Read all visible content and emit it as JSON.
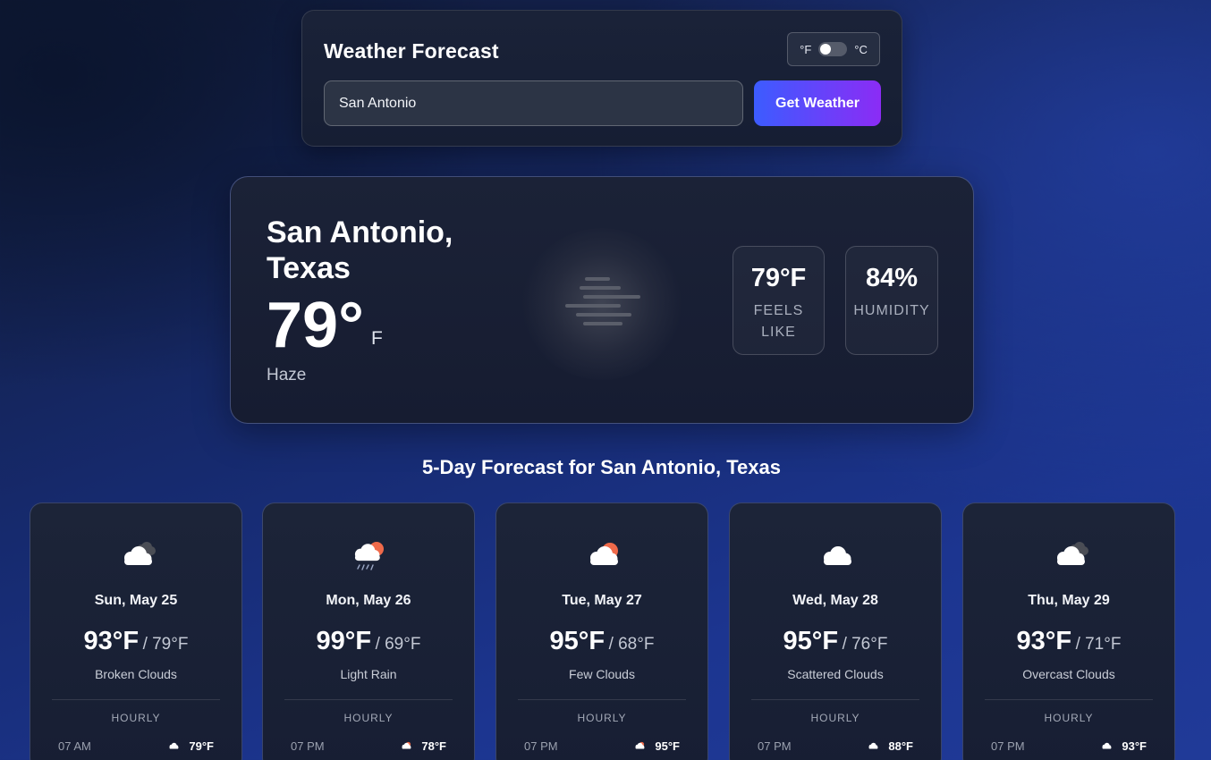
{
  "search": {
    "title": "Weather Forecast",
    "unit_f": "°F",
    "unit_c": "°C",
    "input_value": "San Antonio",
    "button_label": "Get Weather"
  },
  "current": {
    "city": "San Antonio, Texas",
    "temp": "79°",
    "unit": "F",
    "condition": "Haze",
    "icon": "haze-icon",
    "feels_like_value": "79°F",
    "feels_like_label": "FEELS LIKE",
    "humidity_value": "84%",
    "humidity_label": "HUMIDITY"
  },
  "forecast": {
    "title": "5-Day Forecast for San Antonio, Texas",
    "days": [
      {
        "date": "Sun, May 25",
        "high": "93°F",
        "low": "/ 79°F",
        "desc": "Broken Clouds",
        "icon": "broken-clouds-icon",
        "hourly_label": "HOURLY",
        "hour_time": "07 AM",
        "hour_temp": "79°F",
        "hour_icon": "cloud-icon"
      },
      {
        "date": "Mon, May 26",
        "high": "99°F",
        "low": "/ 69°F",
        "desc": "Light Rain",
        "icon": "light-rain-icon",
        "hourly_label": "HOURLY",
        "hour_time": "07 PM",
        "hour_temp": "78°F",
        "hour_icon": "sun-cloud-icon"
      },
      {
        "date": "Tue, May 27",
        "high": "95°F",
        "low": "/ 68°F",
        "desc": "Few Clouds",
        "icon": "few-clouds-icon",
        "hourly_label": "HOURLY",
        "hour_time": "07 PM",
        "hour_temp": "95°F",
        "hour_icon": "sun-cloud-icon"
      },
      {
        "date": "Wed, May 28",
        "high": "95°F",
        "low": "/ 76°F",
        "desc": "Scattered Clouds",
        "icon": "scattered-clouds-icon",
        "hourly_label": "HOURLY",
        "hour_time": "07 PM",
        "hour_temp": "88°F",
        "hour_icon": "cloud-icon"
      },
      {
        "date": "Thu, May 29",
        "high": "93°F",
        "low": "/ 71°F",
        "desc": "Overcast Clouds",
        "icon": "overcast-clouds-icon",
        "hourly_label": "HOURLY",
        "hour_time": "07 PM",
        "hour_temp": "93°F",
        "hour_icon": "cloud-icon"
      }
    ]
  },
  "colors": {
    "button_gradient_start": "#3c5cff",
    "button_gradient_end": "#8b2cf5",
    "sun": "#ef6a4a",
    "card_bg": "#1b2237"
  }
}
